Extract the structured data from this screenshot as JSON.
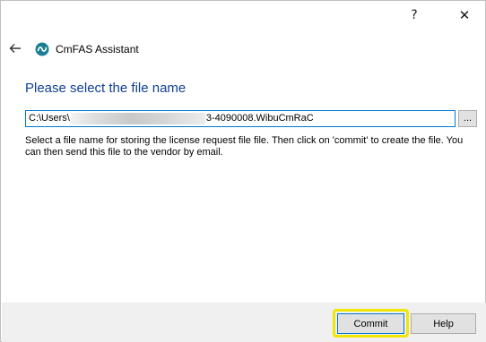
{
  "window": {
    "title_help": "?",
    "close_symbol": "✕",
    "app_title": "CmFAS Assistant"
  },
  "page": {
    "title": "Please select the file name",
    "path_prefix": "C:\\Users\\",
    "path_suffix": "3-4090008.WibuCmRaC",
    "browse_label": "...",
    "description": "Select a file name for storing the license request file file. Then click on 'commit' to create the file. You can then send this file to the vendor by email."
  },
  "footer": {
    "commit_label": "Commit",
    "help_label": "Help"
  },
  "icons": {
    "back": "back-arrow-icon",
    "app": "cmfas-logo-icon",
    "help": "help-icon",
    "close": "close-icon"
  },
  "colors": {
    "title_blue": "#0f3f96",
    "app_icon_teal": "#1b7f93",
    "highlight_yellow": "#f2e600",
    "focus_blue": "#0078d7",
    "footer_bg": "#f0f0f0"
  }
}
